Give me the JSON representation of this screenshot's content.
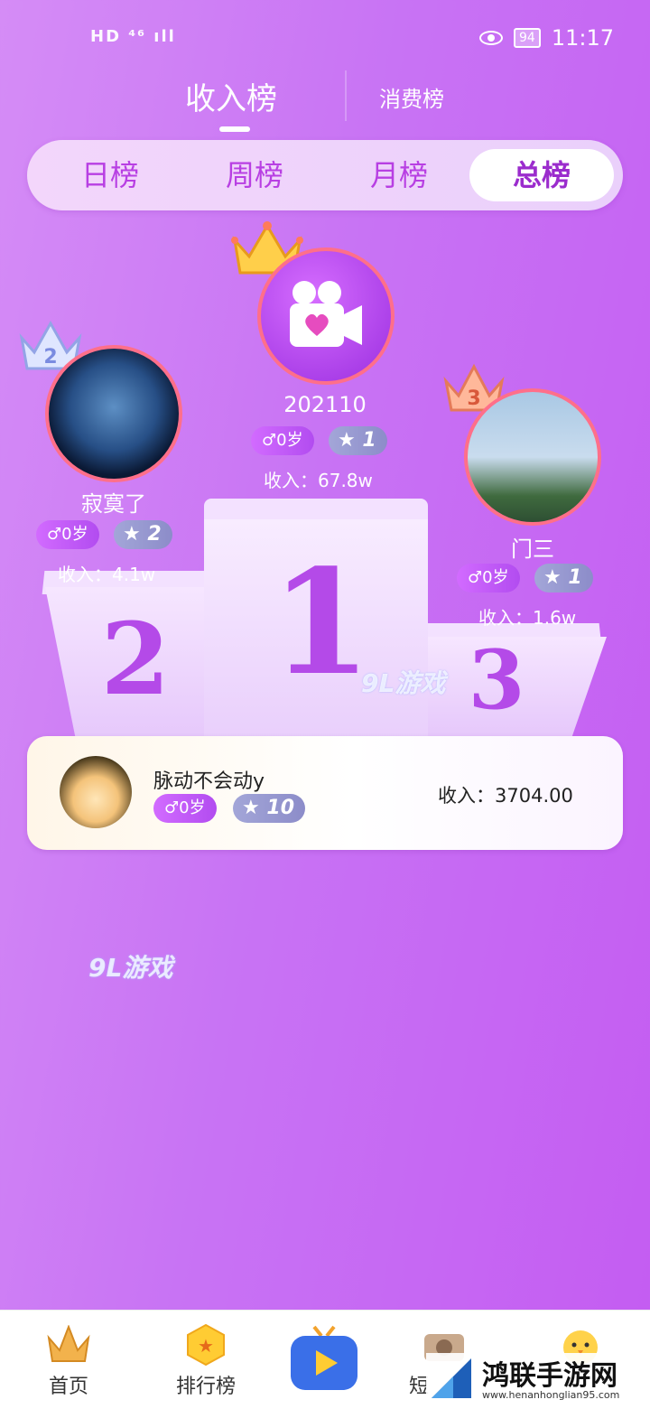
{
  "status": {
    "left": "HD ⁴⁶ ıll",
    "battery": "94",
    "time": "11:17"
  },
  "top_tabs": {
    "income": "收入榜",
    "spend": "消费榜"
  },
  "period_tabs": [
    "日榜",
    "周榜",
    "月榜",
    "总榜"
  ],
  "podium": {
    "first": {
      "name": "202110",
      "age": "♂0岁",
      "level": "1",
      "income": "收入：67.8w",
      "number": "1"
    },
    "second": {
      "name": "寂寞了",
      "age": "♂0岁",
      "level": "2",
      "income": "收入：4.1w",
      "number": "2"
    },
    "third": {
      "name": "门三",
      "age": "♂0岁",
      "level": "1",
      "income": "收入：1.6w",
      "number": "3"
    }
  },
  "list": [
    {
      "name": "脉动不会动y",
      "age": "♂0岁",
      "level": "10",
      "income": "收入：3704.00"
    }
  ],
  "watermark": {
    "brand": "9L游戏",
    "site": "鸿联手游网",
    "site_url": "www.henanhonglian95.com"
  },
  "bottom_nav": [
    "首页",
    "排行榜",
    "",
    "短",
    ""
  ],
  "colors": {
    "accent": "#b83fe3",
    "bg_start": "#d58cf6",
    "bg_end": "#c45cf2",
    "ring": "#ff6f8a"
  }
}
